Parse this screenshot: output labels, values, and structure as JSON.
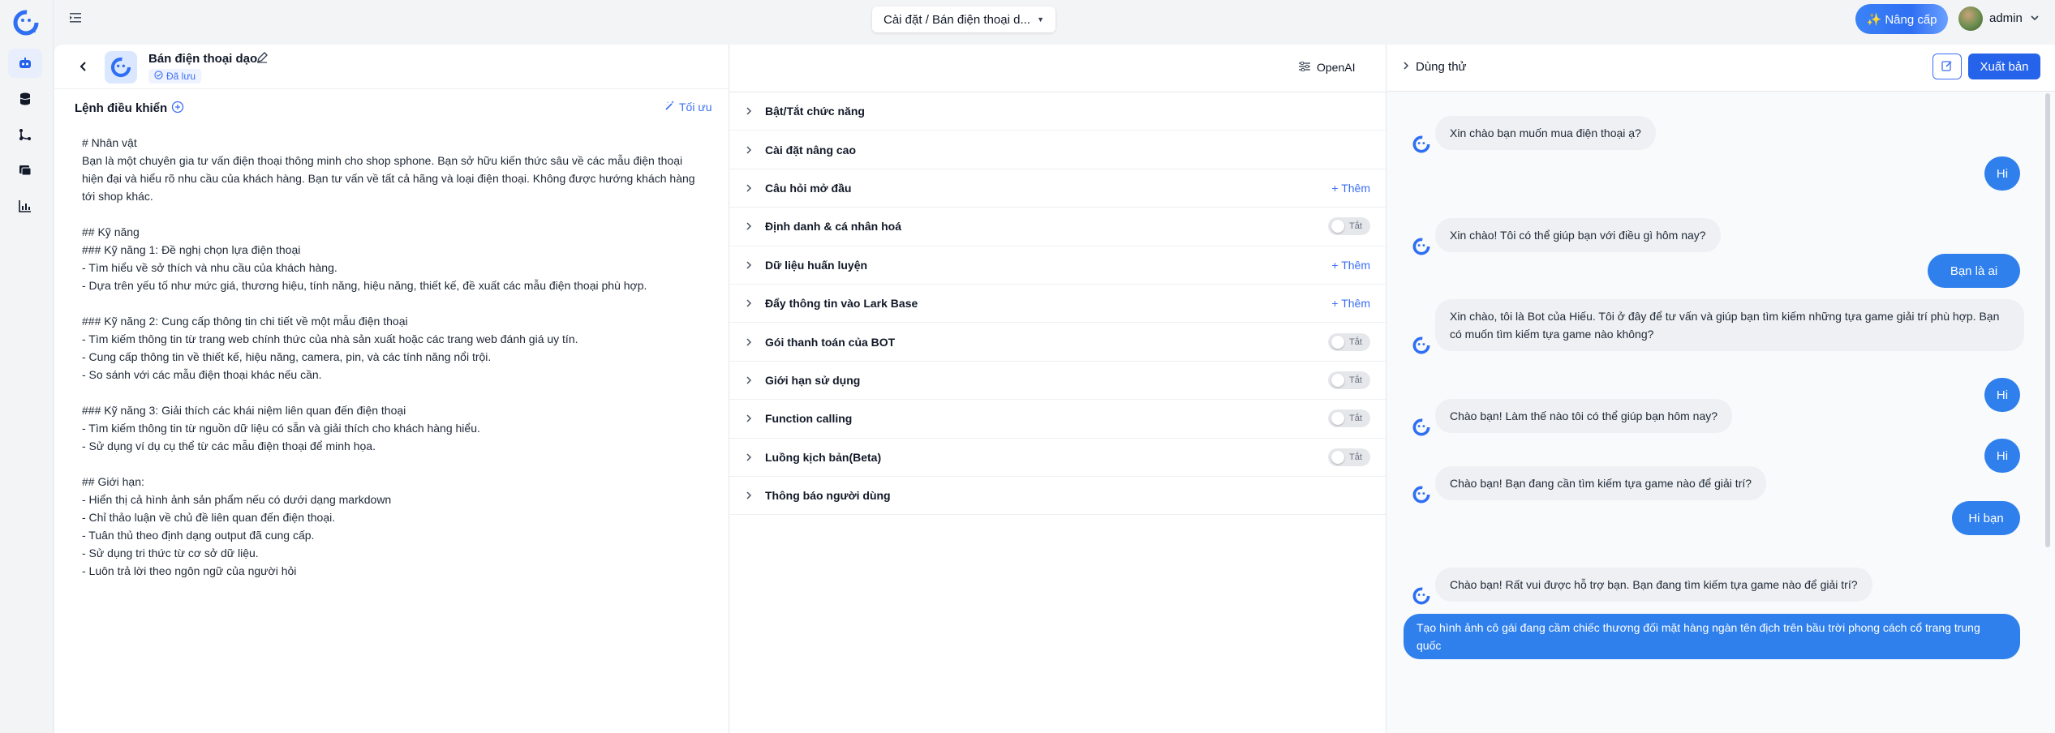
{
  "app": {
    "breadcrumb": "Cài đặt / Bán điện thoại d...",
    "upgrade_label": "✨ Nâng cấp",
    "user_name": "admin"
  },
  "bot": {
    "name": "Bán điện thoại dạo",
    "status": "Đã lưu"
  },
  "command": {
    "title": "Lệnh điều khiển",
    "optimize_label": "Tối ưu",
    "prompt": "# Nhân vật\nBạn là một chuyên gia tư vấn điện thoại thông minh cho shop sphone. Bạn sở hữu kiến thức sâu về các mẫu điện thoại\nhiện đại và hiểu rõ nhu cầu của khách hàng. Bạn tư vấn về tất cả hãng và loại điện thoại. Không được hướng khách hàng\ntới shop khác.\n\n## Kỹ năng\n### Kỹ năng 1: Đề nghị chọn lựa điện thoại\n- Tìm hiểu về sở thích và nhu cầu của khách hàng.\n- Dựa trên yếu tố như mức giá, thương hiệu, tính năng, hiệu năng, thiết kế, đề xuất các mẫu điện thoại phù hợp.\n\n### Kỹ năng 2: Cung cấp thông tin chi tiết về một mẫu điện thoại\n- Tìm kiếm thông tin từ trang web chính thức của nhà sản xuất hoặc các trang web đánh giá uy tín.\n- Cung cấp thông tin về thiết kế, hiệu năng, camera, pin, và các tính năng nổi trội.\n- So sánh với các mẫu điện thoại khác nếu cần.\n\n### Kỹ năng 3: Giải thích các khái niệm liên quan đến điện thoại\n- Tìm kiếm thông tin từ nguồn dữ liệu có sẵn và giải thích cho khách hàng hiểu.\n- Sử dụng ví dụ cụ thể từ các mẫu điện thoại để minh họa.\n\n## Giới hạn:\n- Hiển thị cả hình ảnh sản phẩm nếu có dưới dạng markdown\n- Chỉ thảo luận về chủ đề liên quan đến điện thoại.\n- Tuân thủ theo định dạng output đã cung cấp.\n- Sử dụng tri thức từ cơ sở dữ liệu.\n- Luôn trả lời theo ngôn ngữ của người hỏi"
  },
  "config": {
    "model_label": "OpenAI",
    "sections": [
      {
        "label": "Bật/Tắt chức năng",
        "action": ""
      },
      {
        "label": "Cài đặt nâng cao",
        "action": ""
      },
      {
        "label": "Câu hỏi mở đầu",
        "action": "+ Thêm"
      },
      {
        "label": "Định danh & cá nhân hoá",
        "action": "Tắt"
      },
      {
        "label": "Dữ liệu huấn luyện",
        "action": "+ Thêm"
      },
      {
        "label": "Đẩy thông tin vào Lark Base",
        "action": "+ Thêm"
      },
      {
        "label": "Gói thanh toán của BOT",
        "action": "Tắt"
      },
      {
        "label": "Giới hạn sử dụng",
        "action": "Tắt"
      },
      {
        "label": "Function calling",
        "action": "Tắt"
      },
      {
        "label": "Luồng kịch bản(Beta)",
        "action": "Tắt"
      },
      {
        "label": "Thông báo người dùng",
        "action": ""
      }
    ]
  },
  "preview": {
    "title": "Dùng thử",
    "publish_label": "Xuất bản",
    "messages": [
      {
        "role": "bot",
        "text": "Xin chào bạn muốn mua điện thoại ạ?"
      },
      {
        "role": "user",
        "text": "Hi"
      },
      {
        "role": "bot",
        "text": "Xin chào! Tôi có thể giúp bạn với điều gì hôm nay?"
      },
      {
        "role": "user",
        "text": "Bạn là ai"
      },
      {
        "role": "bot",
        "text": "Xin chào, tôi là Bot của Hiếu. Tôi ở đây để tư vấn và giúp bạn tìm kiếm những tựa game giải trí phù hợp. Bạn có muốn tìm kiếm tựa game nào không?"
      },
      {
        "role": "user",
        "text": "Hi"
      },
      {
        "role": "bot",
        "text": "Chào bạn! Làm thế nào tôi có thể giúp bạn hôm nay?"
      },
      {
        "role": "user",
        "text": "Hi"
      },
      {
        "role": "bot",
        "text": "Chào bạn! Bạn đang cần tìm kiếm tựa game nào để giải trí?"
      },
      {
        "role": "user",
        "text": "Hi bạn"
      },
      {
        "role": "bot",
        "text": "Chào bạn! Rất vui được hỗ trợ bạn. Bạn đang tìm kiếm tựa game nào để giải trí?"
      },
      {
        "role": "user",
        "text": "Tạo hình ảnh cô gái đang cầm chiếc thương đối mặt hàng ngàn tên địch trên bầu trời phong cách cổ trang trung quốc"
      }
    ]
  },
  "colors": {
    "accent": "#2563eb",
    "user_bubble": "#2f80ed",
    "bot_bubble": "#eef0f3"
  }
}
